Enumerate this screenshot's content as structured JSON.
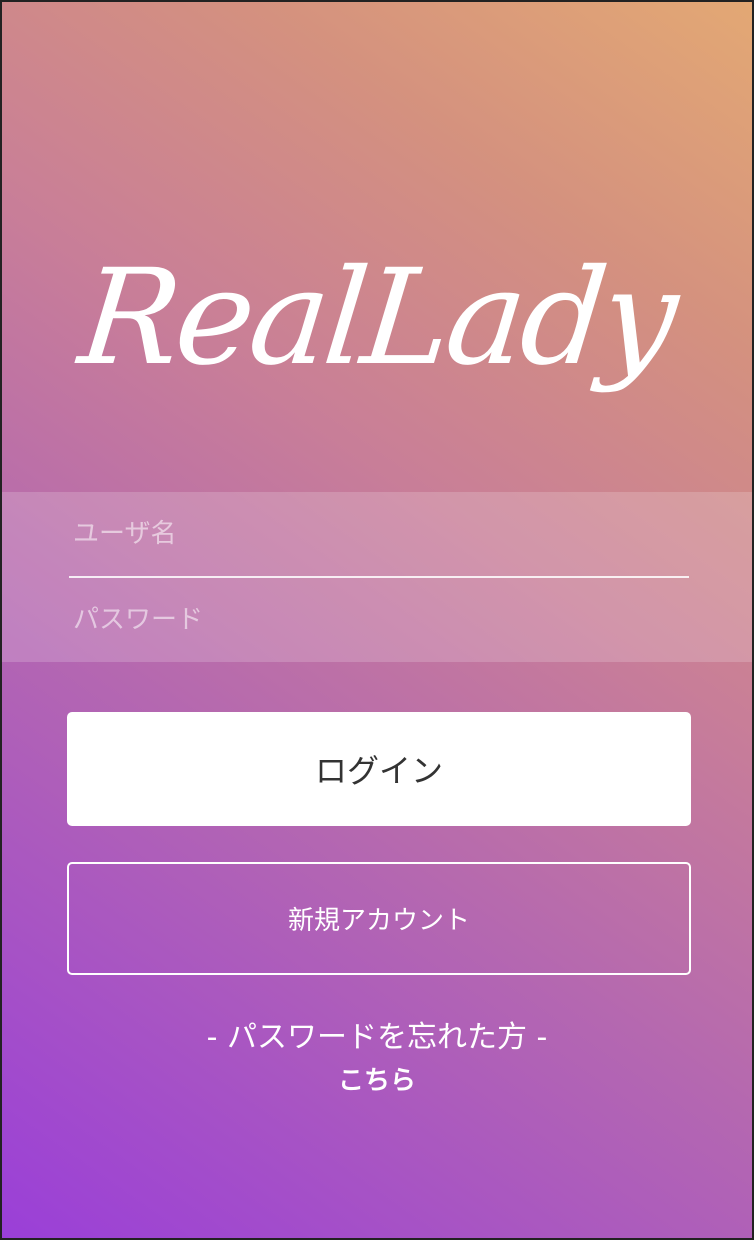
{
  "app": {
    "logo_text": "RealLady"
  },
  "login_form": {
    "username_placeholder": "ユーザ名",
    "password_placeholder": "パスワード",
    "username_value": "",
    "password_value": ""
  },
  "actions": {
    "login_label": "ログイン",
    "register_label": "新規アカウント"
  },
  "forgot_password": {
    "text": "- パスワードを忘れた方 -",
    "link_label": "こちら"
  },
  "colors": {
    "gradient_bottom_left": "#9a3fd8",
    "gradient_top_right": "#e3a874",
    "login_button_bg": "#ffffff",
    "login_button_text": "#333333",
    "text": "#ffffff"
  }
}
